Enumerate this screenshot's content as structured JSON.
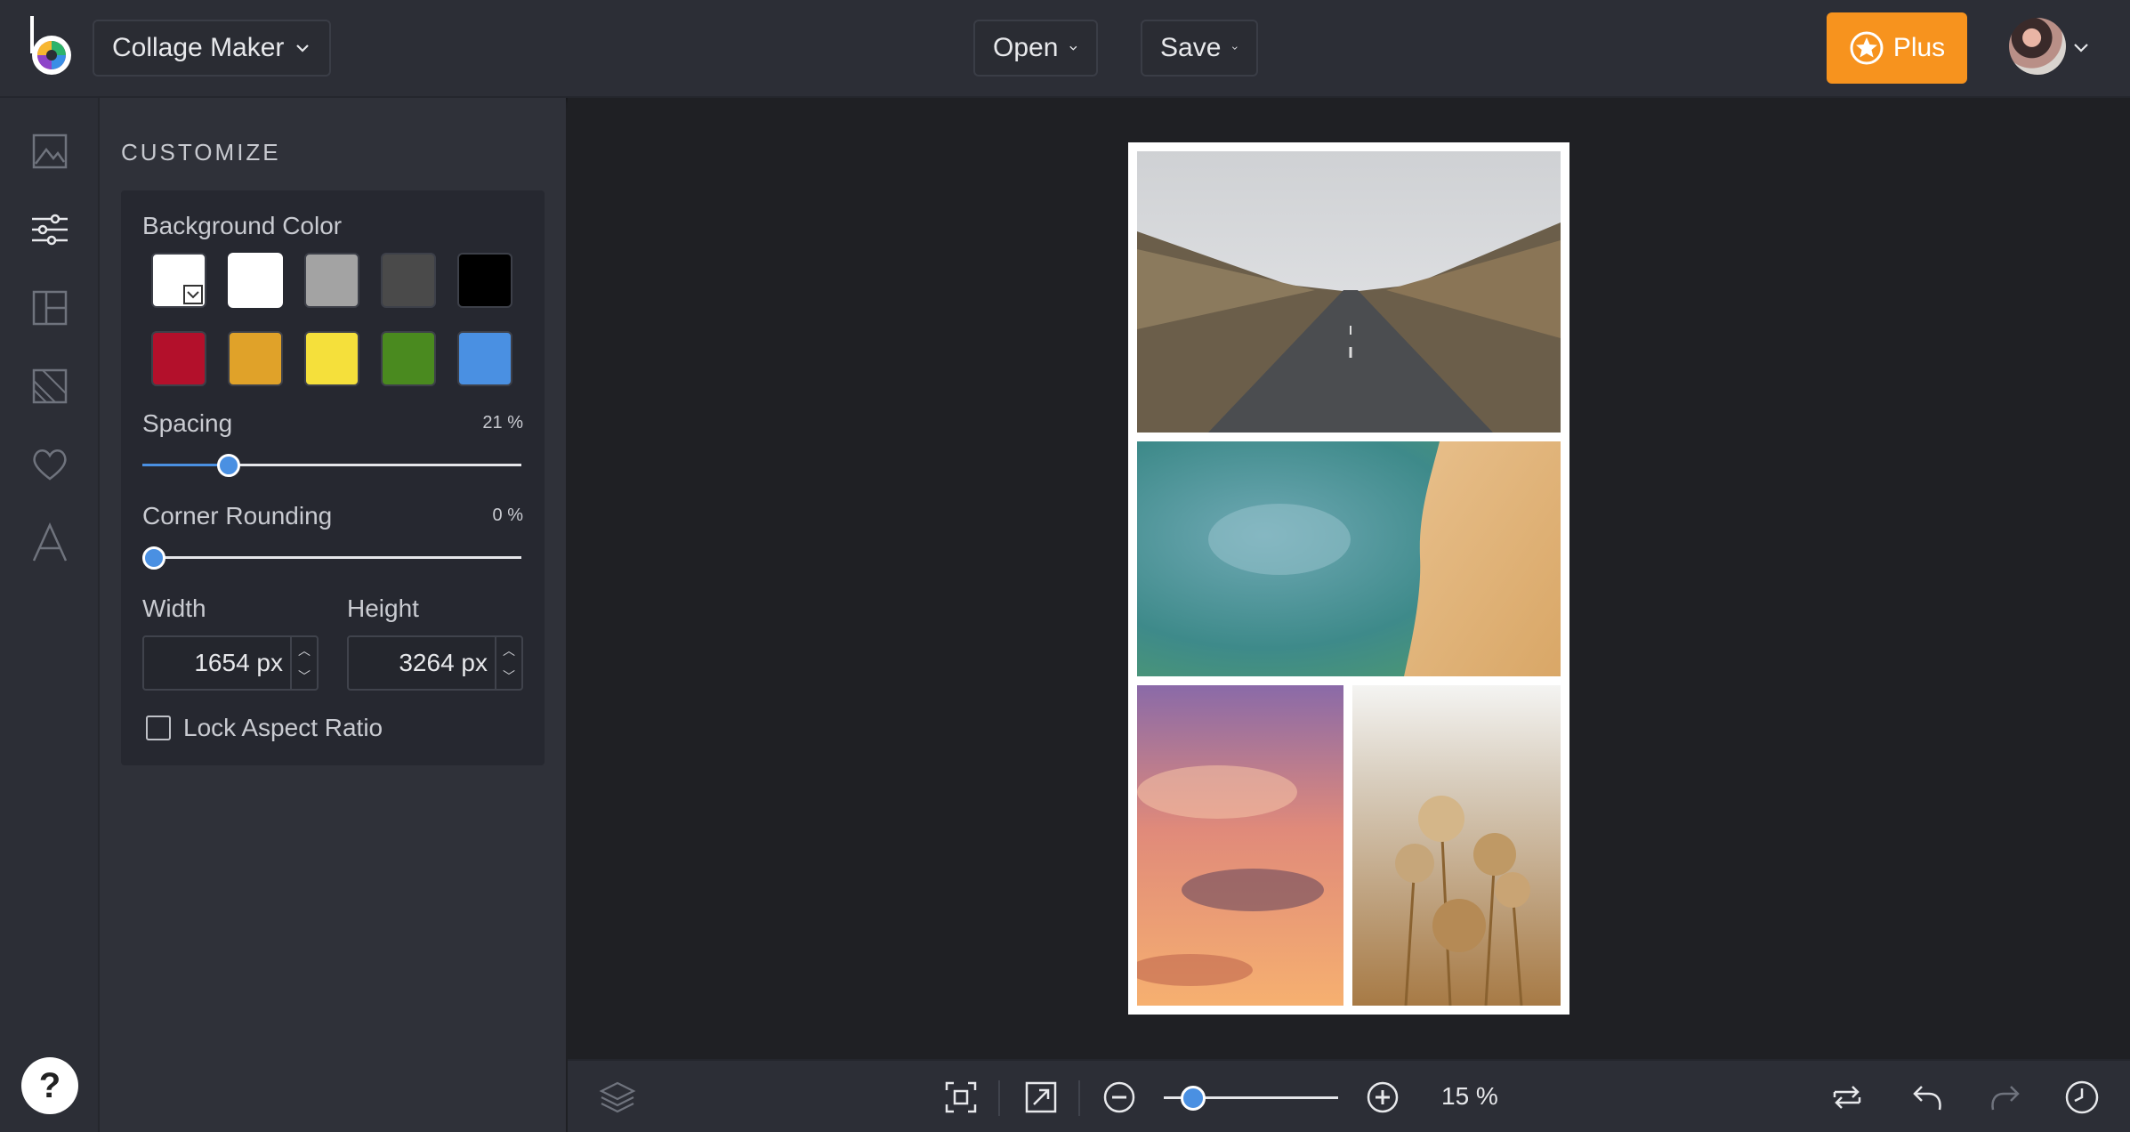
{
  "header": {
    "app_menu_label": "Collage Maker",
    "open_label": "Open",
    "save_label": "Save",
    "plus_label": "Plus"
  },
  "rail": {
    "items": [
      "image-icon",
      "sliders-icon",
      "layout-icon",
      "background-icon",
      "heart-icon",
      "text-icon"
    ],
    "help_label": "?"
  },
  "customize": {
    "title": "CUSTOMIZE",
    "background_color_label": "Background Color",
    "swatches": [
      "#ffffff",
      "#ffffff",
      "#a3a3a3",
      "#4a4a4a",
      "#000000",
      "#b3102b",
      "#e0a229",
      "#f5e03b",
      "#4a8a1f",
      "#4a90e2"
    ],
    "spacing_label": "Spacing",
    "spacing_value": "21 %",
    "spacing_fraction": 0.21,
    "corner_label": "Corner Rounding",
    "corner_value": "0 %",
    "corner_fraction": 0,
    "width_label": "Width",
    "width_value": "1654 px",
    "height_label": "Height",
    "height_value": "3264 px",
    "lock_label": "Lock Aspect Ratio"
  },
  "zoom": {
    "value_label": "15 %",
    "fraction": 0.15
  },
  "colors": {
    "accent": "#4a90e2",
    "plus": "#f7931e"
  }
}
